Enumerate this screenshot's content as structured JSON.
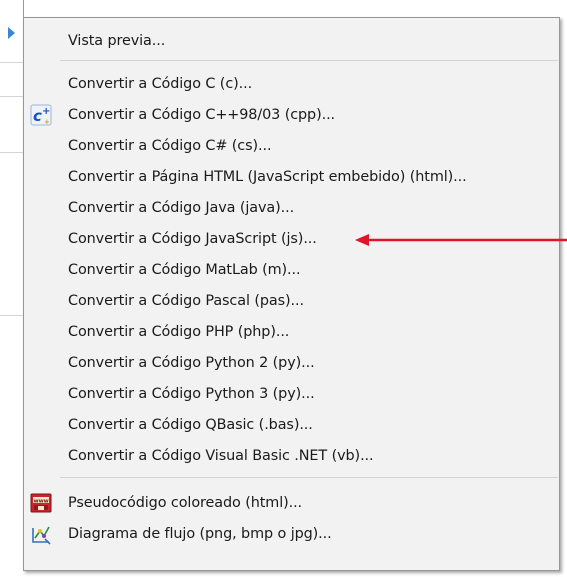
{
  "menu": {
    "preview_label": "Vista previa...",
    "convert_items": [
      "Convertir a Código C (c)...",
      "Convertir a Código C++98/03 (cpp)...",
      "Convertir a Código C# (cs)...",
      "Convertir a Página HTML (JavaScript embebido) (html)...",
      "Convertir a Código Java (java)...",
      "Convertir a Código JavaScript (js)...",
      "Convertir a Código MatLab (m)...",
      "Convertir a Código Pascal (pas)...",
      "Convertir a Código PHP (php)...",
      "Convertir a Código Python 2 (py)...",
      "Convertir a Código Python 3 (py)...",
      "Convertir a Código QBasic (.bas)...",
      "Convertir a Código Visual Basic .NET (vb)..."
    ],
    "colored_pseudocode_label": "Pseudocódigo coloreado (html)...",
    "flowchart_label": "Diagrama de flujo (png, bmp o jpg)..."
  },
  "icons": {
    "cpp": "cpp-icon",
    "www": "www-icon",
    "flowchart": "flowchart-icon",
    "submenu_arrow": "submenu-arrow-icon",
    "annotation_arrow": "red-arrow-icon"
  },
  "colors": {
    "menu_background": "#f2f2f2",
    "annotation_arrow": "#e0142a",
    "submenu_arrow": "#3a86d8"
  }
}
